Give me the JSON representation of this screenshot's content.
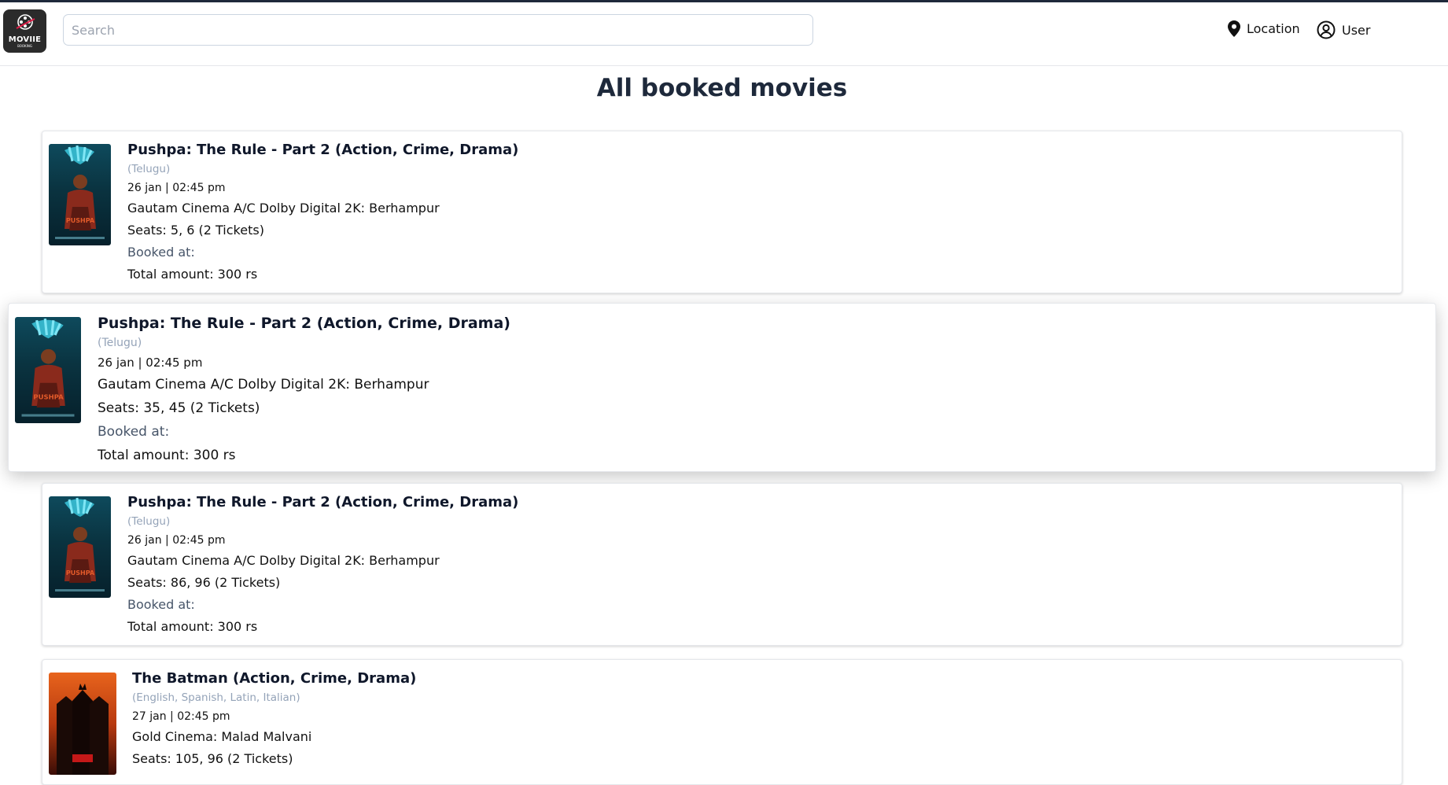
{
  "header": {
    "logo": {
      "name": "MOVIIE",
      "sub": "BOOKING"
    },
    "search_placeholder": "Search",
    "location_label": "Location",
    "user_label": "User"
  },
  "page_title": "All booked movies",
  "bookings": [
    {
      "title": "Pushpa: The Rule - Part 2 (Action, Crime, Drama)",
      "language": "(Telugu)",
      "datetime": "26 jan | 02:45 pm",
      "cinema": "Gautam Cinema A/C Dolby Digital 2K: Berhampur",
      "seats": "Seats: 5, 6 (2 Tickets)",
      "booked_at": "Booked at:",
      "total": "Total amount: 300 rs",
      "poster": "pushpa-poster"
    },
    {
      "title": "Pushpa: The Rule - Part 2 (Action, Crime, Drama)",
      "language": "(Telugu)",
      "datetime": "26 jan | 02:45 pm",
      "cinema": "Gautam Cinema A/C Dolby Digital 2K: Berhampur",
      "seats": "Seats: 35, 45 (2 Tickets)",
      "booked_at": "Booked at:",
      "total": "Total amount: 300 rs",
      "poster": "pushpa-poster"
    },
    {
      "title": "Pushpa: The Rule - Part 2 (Action, Crime, Drama)",
      "language": "(Telugu)",
      "datetime": "26 jan | 02:45 pm",
      "cinema": "Gautam Cinema A/C Dolby Digital 2K: Berhampur",
      "seats": "Seats: 86, 96 (2 Tickets)",
      "booked_at": "Booked at:",
      "total": "Total amount: 300 rs",
      "poster": "pushpa-poster"
    },
    {
      "title": "The Batman (Action, Crime, Drama)",
      "language": "(English, Spanish, Latin, Italian)",
      "datetime": "27 jan | 02:45 pm",
      "cinema": "Gold Cinema: Malad Malvani",
      "seats": "Seats: 105, 96 (2 Tickets)",
      "poster": "batman-poster"
    }
  ]
}
